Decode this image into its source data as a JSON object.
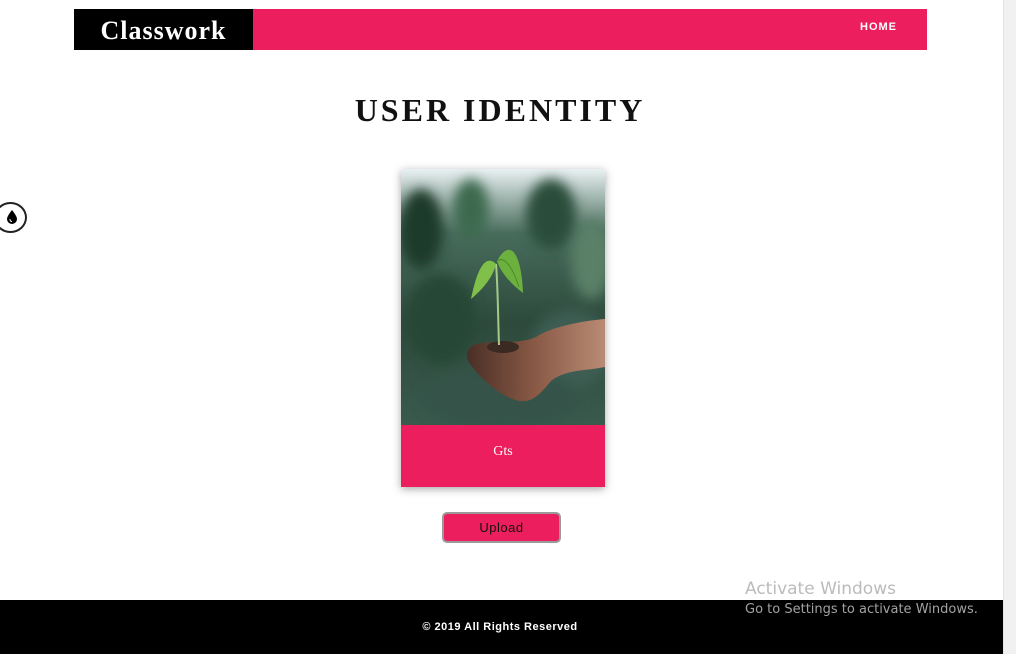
{
  "navbar": {
    "brand": "Classwork",
    "home_link": "HOME"
  },
  "main": {
    "title": "USER IDENTITY",
    "card": {
      "image_icon": "seedling-in-hand-image",
      "caption": "Gts"
    },
    "upload_button": "Upload"
  },
  "side_toggle": {
    "icon": "water-drop-icon"
  },
  "footer": {
    "copyright": "© 2019 All Rights Reserved"
  },
  "windows_watermark": {
    "title": "Activate Windows",
    "subtitle": "Go to Settings to activate Windows."
  },
  "colors": {
    "accent": "#ec1e5e",
    "brand_bg": "#000000",
    "footer_bg": "#000000"
  }
}
